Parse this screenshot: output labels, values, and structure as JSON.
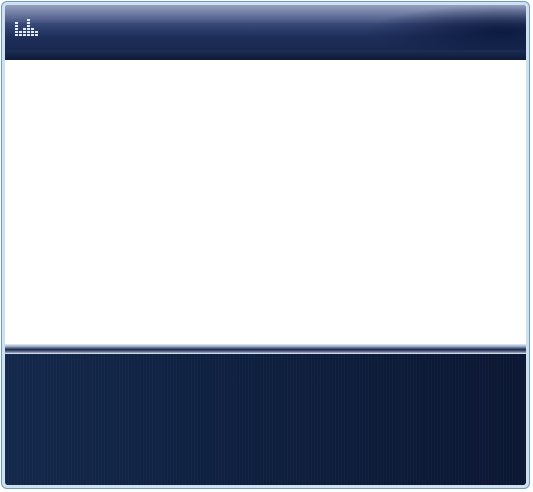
{
  "window": {
    "app_icon": "equalizer-icon"
  },
  "colors": {
    "titlebar": "#2a3a68",
    "frame": "#6f9cc4",
    "content": "#ffffff",
    "bottom_panel": "#0e1f3e"
  }
}
